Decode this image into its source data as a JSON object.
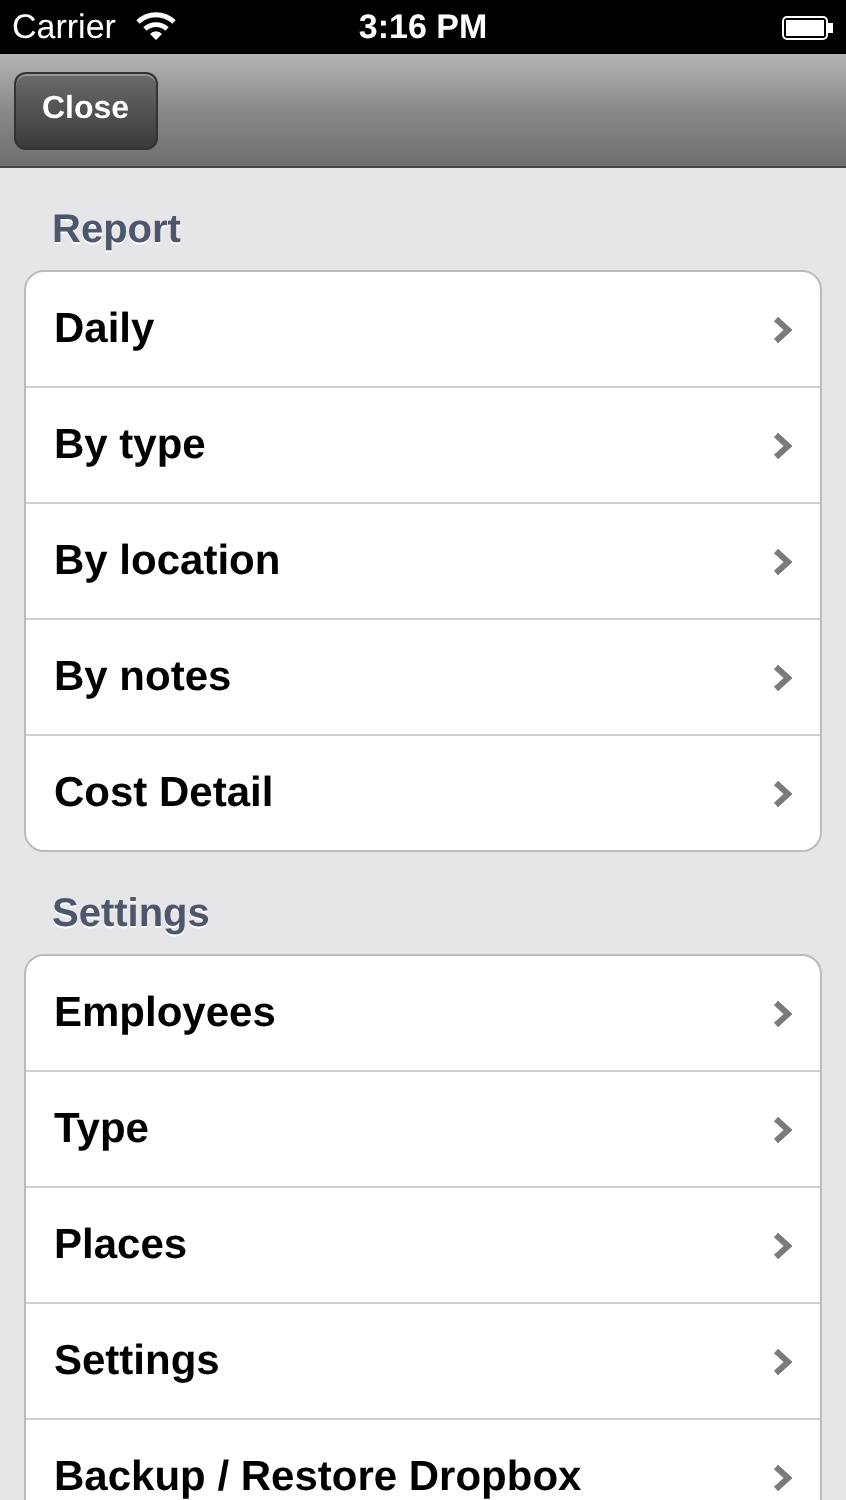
{
  "status_bar": {
    "carrier": "Carrier",
    "time": "3:16 PM"
  },
  "nav_bar": {
    "close_button": "Close"
  },
  "sections": [
    {
      "header": "Report",
      "items": [
        {
          "label": "Daily"
        },
        {
          "label": "By type"
        },
        {
          "label": "By location"
        },
        {
          "label": "By notes"
        },
        {
          "label": "Cost Detail"
        }
      ]
    },
    {
      "header": "Settings",
      "items": [
        {
          "label": "Employees"
        },
        {
          "label": "Type"
        },
        {
          "label": "Places"
        },
        {
          "label": "Settings"
        },
        {
          "label": "Backup / Restore Dropbox"
        }
      ]
    }
  ]
}
